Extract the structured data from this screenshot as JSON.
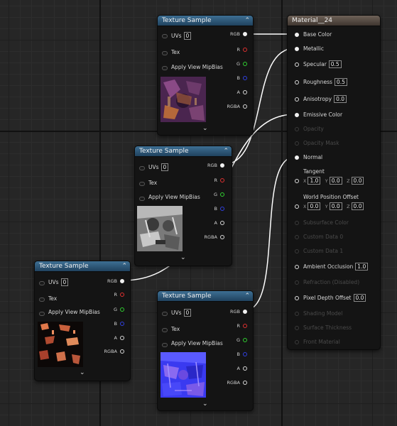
{
  "nodes": {
    "tex_top": {
      "title": "Texture Sample",
      "inputs": {
        "uvs": "UVs",
        "uvs_value": "0",
        "tex": "Tex",
        "apply": "Apply View MipBias"
      },
      "outputs": [
        "RGB",
        "R",
        "G",
        "B",
        "A",
        "RGBA"
      ],
      "thumb": "purple"
    },
    "tex_mid": {
      "title": "Texture Sample",
      "inputs": {
        "uvs": "UVs",
        "uvs_value": "0",
        "tex": "Tex",
        "apply": "Apply View MipBias"
      },
      "outputs": [
        "RGB",
        "R",
        "G",
        "B",
        "A",
        "RGBA"
      ],
      "thumb": "gray"
    },
    "tex_left": {
      "title": "Texture Sample",
      "inputs": {
        "uvs": "UVs",
        "uvs_value": "0",
        "tex": "Tex",
        "apply": "Apply View MipBias"
      },
      "outputs": [
        "RGB",
        "R",
        "G",
        "B",
        "A",
        "RGBA"
      ],
      "thumb": "dark-orange"
    },
    "tex_bottom": {
      "title": "Texture Sample",
      "inputs": {
        "uvs": "UVs",
        "uvs_value": "0",
        "tex": "Tex",
        "apply": "Apply View MipBias"
      },
      "outputs": [
        "RGB",
        "R",
        "G",
        "B",
        "A",
        "RGBA"
      ],
      "thumb": "blue"
    }
  },
  "material": {
    "title": "Material__24",
    "base_color": "Base Color",
    "metallic": "Metallic",
    "specular": "Specular",
    "specular_value": "0.5",
    "roughness": "Roughness",
    "roughness_value": "0.5",
    "anisotropy": "Anisotropy",
    "anisotropy_value": "0.0",
    "emissive": "Emissive Color",
    "opacity": "Opacity",
    "opacity_mask": "Opacity Mask",
    "normal": "Normal",
    "tangent": "Tangent",
    "tangent_x": "1.0",
    "tangent_y": "0.0",
    "tangent_z": "0.0",
    "wpo": "World Position Offset",
    "wpo_x": "0.0",
    "wpo_y": "0.0",
    "wpo_z": "0.0",
    "subsurface": "Subsurface Color",
    "custom0": "Custom Data 0",
    "custom1": "Custom Data 1",
    "ao": "Ambient Occlusion",
    "ao_value": "1.0",
    "refraction": "Refraction (Disabled)",
    "pdo": "Pixel Depth Offset",
    "pdo_value": "0.0",
    "shading_model": "Shading Model",
    "surface_thickness": "Surface Thickness",
    "front_material": "Front Material",
    "axis_x": "X",
    "axis_y": "Y",
    "axis_z": "Z"
  },
  "colors": {
    "header_blue": "#2f5a7c",
    "material_header": "#5a4d44",
    "wire": "#ffffff"
  }
}
